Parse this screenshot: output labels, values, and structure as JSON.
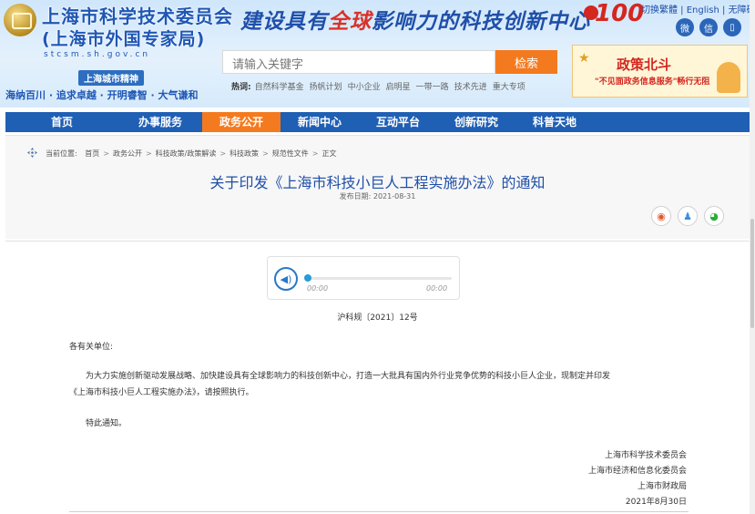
{
  "header": {
    "site_name": "上海市科学技术委员会",
    "site_sub": "(上海市外国专家局)",
    "domain": "stcsm.sh.gov.cn",
    "spirit_title": "上海城市精神",
    "spirit": "海纳百川 · 追求卓越 · 开明睿智 · 大气谦和",
    "slogan_part1": "建设具有",
    "slogan_red": "全球",
    "slogan_part2": "影响力的科技创新中心",
    "badge_number": "100",
    "topbar": [
      "切换繁體",
      "English",
      "无障碍"
    ],
    "social": [
      "微博",
      "微信",
      "手机"
    ]
  },
  "search": {
    "placeholder": "请输入关键字",
    "button": "检索",
    "hot_label": "热词:",
    "hot_words": [
      "自然科学基金",
      "扬帆计划",
      "中小企业",
      "启明星",
      "一带一路",
      "技术先进",
      "重大专项"
    ]
  },
  "promo": {
    "title": "政策北斗",
    "sub": "\"不见面政务信息服务\"畅行无阻"
  },
  "nav": [
    "首页",
    "办事服务",
    "政务公开",
    "新闻中心",
    "互动平台",
    "创新研究",
    "科普天地"
  ],
  "nav_active_index": 2,
  "breadcrumb": {
    "label": "当前位置:",
    "items": [
      "首页",
      "政务公开",
      "科技政策/政策解读",
      "科技政策",
      "规范性文件",
      "正文"
    ]
  },
  "article": {
    "title": "关于印发《上海市科技小巨人工程实施办法》的通知",
    "pubdate": "发布日期: 2021-08-31",
    "share": [
      "weibo",
      "qq",
      "wechat"
    ],
    "audio": {
      "current": "00:00",
      "total": "00:00",
      "progress": 0
    },
    "doc_no": "沪科规〔2021〕12号",
    "salutation": "各有关单位:",
    "para1_line1": "为大力实施创新驱动发展战略、加快建设具有全球影响力的科技创新中心，打造一大批具有国内外行业竞争优势的科技小巨人企业，现制定并印发",
    "para1_line2": "《上海市科技小巨人工程实施办法》，请按照执行。",
    "closing": "特此通知。",
    "signers": [
      "上海市科学技术委员会",
      "上海市经济和信息化委员会",
      "上海市财政局"
    ],
    "sign_date": "2021年8月30日"
  },
  "colors": {
    "nav_bg": "#1f5fb4",
    "accent": "#f47a1f",
    "title": "#1f4fa8"
  }
}
